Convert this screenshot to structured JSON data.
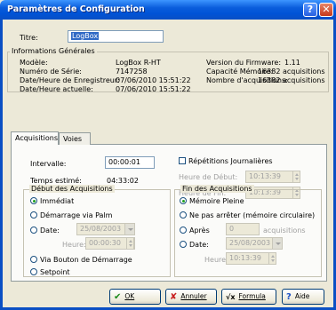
{
  "window": {
    "title": "Paramètres de Configuration",
    "help_glyph": "?",
    "close_glyph": "✕"
  },
  "titre": {
    "label": "Titre:",
    "value": "LogBox"
  },
  "info": {
    "group_title": "Informations Générales",
    "modele_label": "Modèle:",
    "modele_value": "LogBox R-HT",
    "serie_label": "Numéro de Série:",
    "serie_value": "7147258",
    "date_enreg_label": "Date/Heure de Enregistreur:",
    "date_enreg_value": "07/06/2010 15:51:22",
    "date_actuelle_label": "Date/Heure actuelle:",
    "date_actuelle_value": "07/06/2010 15:51:22",
    "firmware_label": "Version du Firmware:",
    "firmware_value": "1.11",
    "capacite_label": "Capacité Mémoire:",
    "capacite_value": "16382 acquisitions",
    "nb_acq_label": "Nombre d'acquisitions:",
    "nb_acq_value": "16382 acquisitions"
  },
  "tabs": {
    "acquisitions": "Acquisitions",
    "voies": "Voies"
  },
  "intervalle": {
    "label": "Intervalle:",
    "value": "00:00:01"
  },
  "temps": {
    "label": "Temps estimé:",
    "value": "04:33:02"
  },
  "repetitions": {
    "label": "Répétitions Journalières",
    "heure_debut_label": "Heure de Début:",
    "heure_debut_value": "10:13:39",
    "heure_fin_label": "Heure de Fin:",
    "heure_fin_value": "10:13:39"
  },
  "debut": {
    "group_title": "Début des Acquisitions",
    "immediat": "Immédiat",
    "palm": "Démarrage via Palm",
    "date_label": "Date:",
    "date_value": "25/08/2003",
    "heure_label": "Heure:",
    "heure_value": "00:00:30",
    "bouton": "Via Bouton de Démarrage",
    "setpoint": "Setpoint"
  },
  "fin": {
    "group_title": "Fin des Acquisitions",
    "memoire": "Mémoire Pleine",
    "ne_pas": "Ne pas arrêter (mémoire circulaire)",
    "apres": "Après",
    "apres_value": "0",
    "apres_unit": "acquisitions",
    "date_label": "Date:",
    "date_value": "25/08/2003",
    "heure_label": "Heure:",
    "heure_value": "10:13:39"
  },
  "buttons": {
    "ok": "OK",
    "ok_icon": "✔",
    "annuler": "Annuler",
    "annuler_icon": "✘",
    "formula": "Formula",
    "formula_icon": "√x",
    "aide": "Aide",
    "aide_icon": "?"
  }
}
